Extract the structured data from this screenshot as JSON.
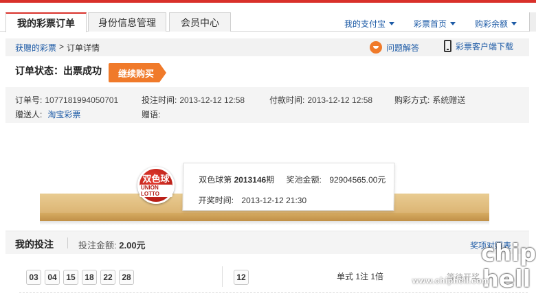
{
  "tabs": [
    {
      "label": "我的彩票订单"
    },
    {
      "label": "身份信息管理"
    },
    {
      "label": "会员中心"
    }
  ],
  "top_links": [
    {
      "label": "我的支付宝"
    },
    {
      "label": "彩票首页"
    },
    {
      "label": "购彩余额"
    }
  ],
  "breadcrumb": {
    "link": "获赠的彩票",
    "sep": ">",
    "current": "订单详情"
  },
  "help": {
    "label": "问题解答"
  },
  "download": {
    "label": "彩票客户端下载"
  },
  "status": {
    "label": "订单状态：",
    "value": "出票成功",
    "button": "继续购买"
  },
  "order": {
    "id_label": "订单号:",
    "id": "1077181994050701",
    "bet_time_label": "投注时间:",
    "bet_time": "2013-12-12 12:58",
    "pay_time_label": "付款时间:",
    "pay_time": "2013-12-12 12:58",
    "method_label": "购彩方式:",
    "method": "系统赠送",
    "sender_label": "赠送人:",
    "sender": "淘宝彩票",
    "message_label": "赠语:",
    "message": ""
  },
  "draw": {
    "logo_line1": "双色球",
    "logo_line2": "UNION LOTTO",
    "prefix": "双色球第 ",
    "issue": "2013146",
    "suffix": "期",
    "pool_label": "奖池金额:",
    "pool": "92904565.00元",
    "time_label": "开奖时间:",
    "time": "2013-12-12 21:30"
  },
  "bets": {
    "title": "我的投注",
    "amount_label": "投注金额:",
    "amount": "2.00元",
    "link": "奖项对照表",
    "red_balls": [
      "03",
      "04",
      "15",
      "18",
      "22",
      "28"
    ],
    "blue_ball": "12",
    "type": "单式 1注 1倍",
    "state": "等待开奖"
  },
  "watermark": {
    "url": "www.chiphell.com",
    "logo": "chip hell"
  },
  "colors": {
    "accent": "#d9302a",
    "orange": "#f07a2a",
    "link": "#1c5aa6"
  }
}
